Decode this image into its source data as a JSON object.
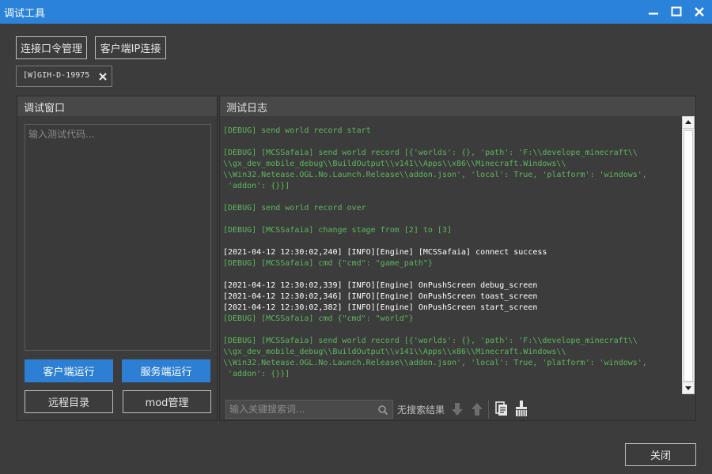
{
  "window": {
    "title": "调试工具"
  },
  "toolbar": {
    "connect_cmd_label": "连接口令管理",
    "client_ip_label": "客户端IP连接"
  },
  "device_tag": {
    "label": "[W]GIH-D-19975"
  },
  "debug_panel": {
    "title": "调试窗口",
    "input_placeholder": "输入测试代码...",
    "client_run_label": "客户端运行",
    "server_run_label": "服务端运行",
    "remote_dir_label": "远程目录",
    "mod_manage_label": "mod管理"
  },
  "log_panel": {
    "title": "测试日志",
    "lines": [
      {
        "text": "[DEBUG] send world record start",
        "kind": "g"
      },
      {
        "text": "",
        "kind": "g"
      },
      {
        "text": "[DEBUG] [MCSSafaia] send world record [{'worlds': {}, 'path': 'F:\\\\develope_minecraft\\\\",
        "kind": "g"
      },
      {
        "text": "\\\\gx_dev_mobile_debug\\\\BuildOutput\\\\v141\\\\Apps\\\\x86\\\\Minecraft.Windows\\\\",
        "kind": "g"
      },
      {
        "text": "\\\\Win32.Netease.OGL.No.Launch.Release\\\\addon.json', 'local': True, 'platform': 'windows',",
        "kind": "g"
      },
      {
        "text": " 'addon': {}}]",
        "kind": "g"
      },
      {
        "text": "",
        "kind": "g"
      },
      {
        "text": "[DEBUG] send world record over",
        "kind": "g"
      },
      {
        "text": "",
        "kind": "g"
      },
      {
        "text": "[DEBUG] [MCSSafaia] change stage from [2] to [3]",
        "kind": "g"
      },
      {
        "text": "",
        "kind": "g"
      },
      {
        "text": "[2021-04-12 12:30:02,240] [INFO][Engine] [MCSSafaia] connect success",
        "kind": "w"
      },
      {
        "text": "[DEBUG] [MCSSafaia] cmd {\"cmd\": \"game_path\"}",
        "kind": "g"
      },
      {
        "text": "",
        "kind": "g"
      },
      {
        "text": "[2021-04-12 12:30:02,339] [INFO][Engine] OnPushScreen debug_screen",
        "kind": "w"
      },
      {
        "text": "[2021-04-12 12:30:02,346] [INFO][Engine] OnPushScreen toast_screen",
        "kind": "w"
      },
      {
        "text": "[2021-04-12 12:30:02,382] [INFO][Engine] OnPushScreen start_screen",
        "kind": "w"
      },
      {
        "text": "[DEBUG] [MCSSafaia] cmd {\"cmd\": \"world\"}",
        "kind": "g"
      },
      {
        "text": "",
        "kind": "g"
      },
      {
        "text": "[DEBUG] [MCSSafaia] send world record [{'worlds': {}, 'path': 'F:\\\\develope_minecraft\\\\",
        "kind": "g"
      },
      {
        "text": "\\\\gx_dev_mobile_debug\\\\BuildOutput\\\\v141\\\\Apps\\\\x86\\\\Minecraft.Windows\\\\",
        "kind": "g"
      },
      {
        "text": "\\\\Win32.Netease.OGL.No.Launch.Release\\\\addon.json', 'local': True, 'platform': 'windows',",
        "kind": "g"
      },
      {
        "text": " 'addon': {}}]",
        "kind": "g"
      }
    ],
    "search_placeholder": "输入关键搜索词...",
    "no_result_label": "无搜索结果"
  },
  "footer": {
    "close_label": "关闭"
  },
  "colors": {
    "titlebar": "#2b82d9",
    "primary_button": "#2d7fd3",
    "log_debug": "#5cb85c",
    "log_info": "#ffffff",
    "background": "#3c3c3c"
  }
}
